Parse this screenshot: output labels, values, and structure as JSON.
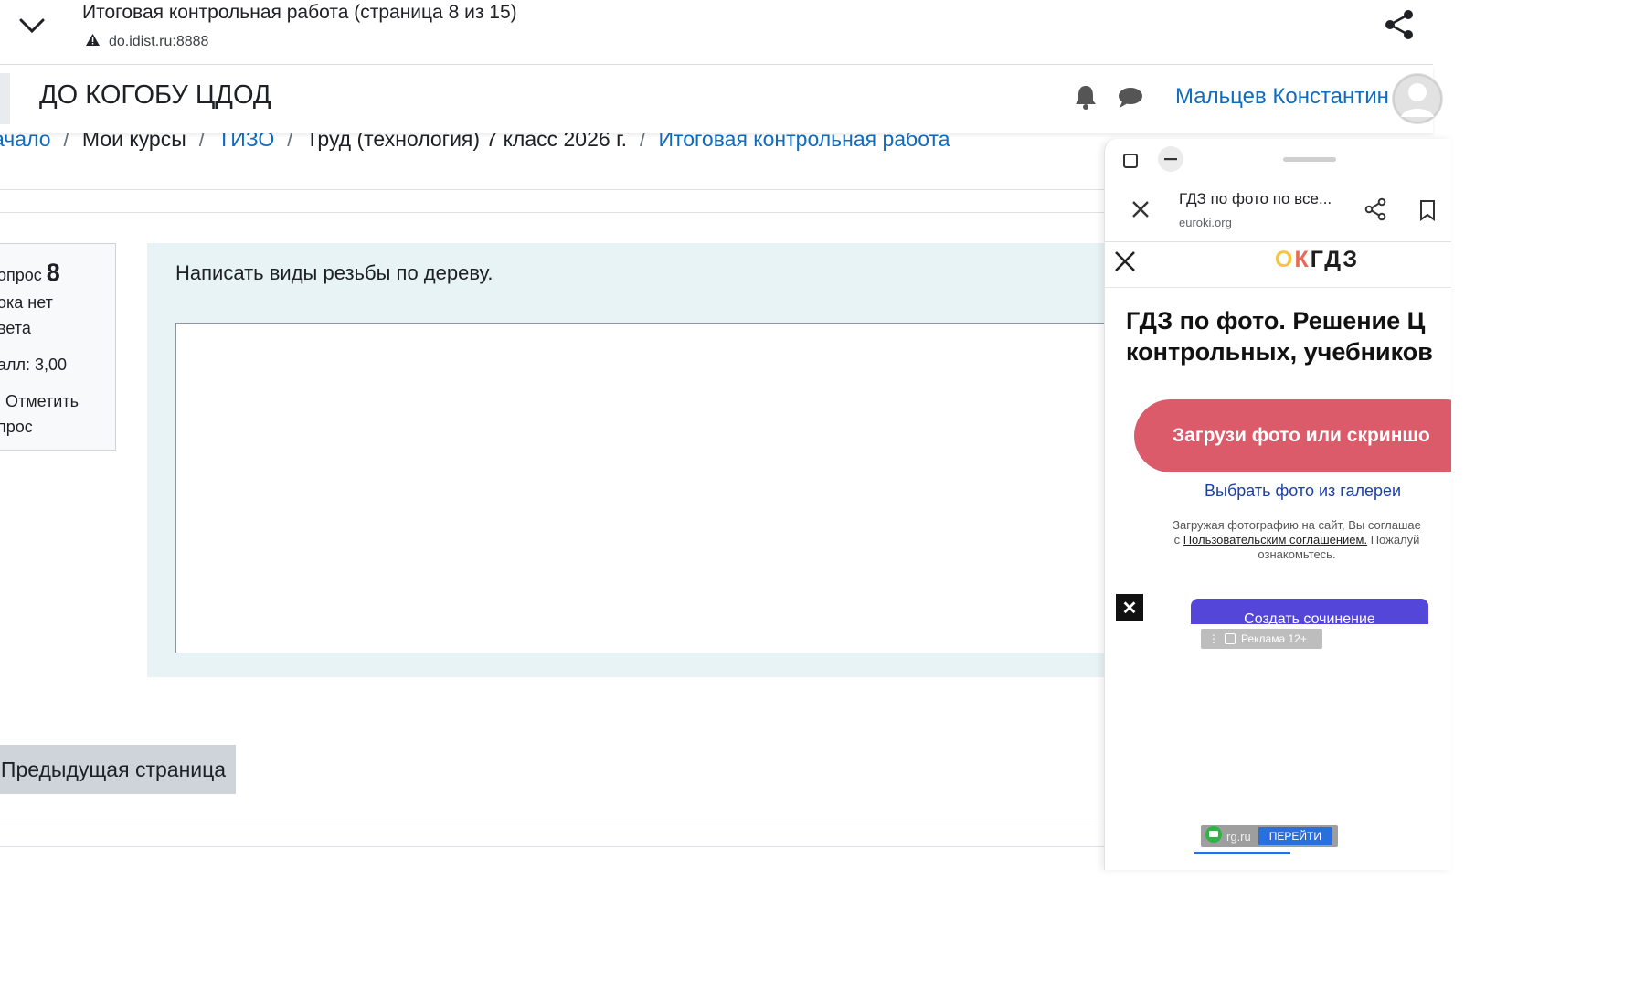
{
  "browser": {
    "page_title": "Итоговая контрольная работа (страница 8 из 15)",
    "url": "do.idist.ru:8888",
    "icons": {
      "collapse": "chevron-down-icon",
      "warning": "warning-icon",
      "share": "share-icon"
    }
  },
  "navbar": {
    "site_name": "ДО КОГОБУ ЦДОД",
    "user_name": "Мальцев Константин",
    "icons": {
      "notifications": "bell-icon",
      "messages": "chat-icon"
    }
  },
  "breadcrumb": {
    "items": [
      {
        "label": "ачало",
        "link": true
      },
      {
        "label": "Мои курсы",
        "link": false
      },
      {
        "label": "ТИЗО",
        "link": true
      },
      {
        "label": "Труд (технология) 7 класс 2026 г.",
        "link": false
      },
      {
        "label": "Итоговая контрольная работа",
        "link": true
      }
    ],
    "separator": "/"
  },
  "question_info": {
    "label": "опрос",
    "number": "8",
    "status_line1": "ока нет",
    "status_line2": "вета",
    "points": "алл: 3,00",
    "flag_line1": "Отметить",
    "flag_line2": "прос"
  },
  "question": {
    "text": "Написать виды резьбы по дереву.",
    "answer_value": ""
  },
  "navigation": {
    "prev_button": "Предыдущая страница"
  },
  "floating_panel": {
    "tab_title": "ГДЗ по фото по все...",
    "tab_url": "euroki.org",
    "site": {
      "logo_o": "О",
      "logo_k": "К",
      "logo_rest": "ГДЗ",
      "heading_line1": "ГДЗ по фото. Решение Ц",
      "heading_line2": "контрольных, учебников",
      "upload_button": "Загрузи фото или скриншо",
      "gallery_link": "Выбрать фото из галереи",
      "consent_line1": "Загружая фотографию на сайт, Вы соглашае",
      "consent_prefix": "с ",
      "consent_link": "Пользовательским соглашением.",
      "consent_suffix": " Пожалуй",
      "consent_line3": "ознакомьтесь.",
      "purple_button": "Создать сочинение"
    },
    "ad": {
      "close_symbol": "✕",
      "label": "Реклама 12+",
      "banner_site": "rg.ru",
      "banner_button": "ПЕРЕЙТИ"
    }
  },
  "colors": {
    "link": "#0f6cbf",
    "question_bg": "#e7f3f5",
    "button_grey": "#ced4da",
    "upload_pink": "#dc5b6b",
    "gallery_blue": "#1a3fa7",
    "purple": "#5446d9"
  }
}
